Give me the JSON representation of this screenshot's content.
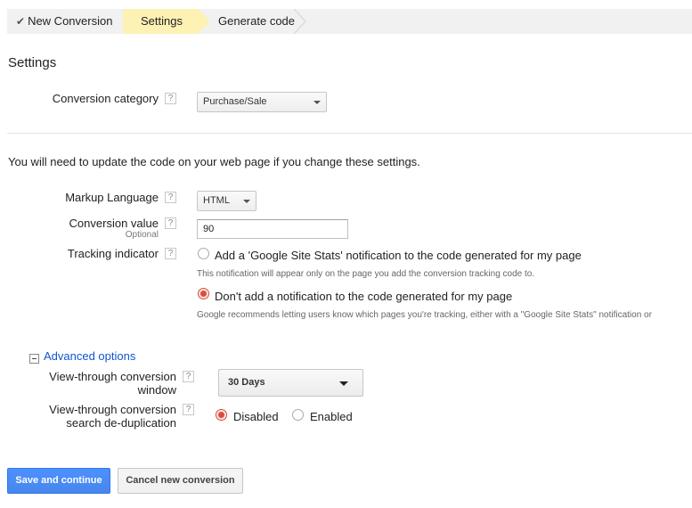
{
  "breadcrumb": {
    "steps": [
      {
        "label": "New Conversion",
        "state": "done"
      },
      {
        "label": "Settings",
        "state": "active"
      },
      {
        "label": "Generate code",
        "state": "pending"
      }
    ]
  },
  "settings": {
    "title": "Settings",
    "conversion_category": {
      "label": "Conversion category",
      "value": "Purchase/Sale"
    }
  },
  "notice": "You will need to update the code on your web page if you change these settings.",
  "markup_language": {
    "label": "Markup Language",
    "value": "HTML"
  },
  "conversion_value": {
    "label": "Conversion value",
    "sublabel": "Optional",
    "value": "90"
  },
  "tracking_indicator": {
    "label": "Tracking indicator",
    "options": [
      {
        "label": "Add a 'Google Site Stats' notification to the code generated for my page",
        "hint": "This notification will appear only on the page you add the conversion tracking code to.",
        "selected": false
      },
      {
        "label": "Don't add a notification to the code generated for my page",
        "hint": "Google recommends letting users know which pages you're tracking, either with a \"Google Site Stats\" notification or",
        "selected": true
      }
    ]
  },
  "advanced": {
    "toggle_label": "Advanced options",
    "view_through_window": {
      "label_line1": "View-through conversion",
      "label_line2": "window",
      "value": "30 Days"
    },
    "dedup": {
      "label_line1": "View-through conversion",
      "label_line2": "search de-duplication",
      "options": [
        {
          "label": "Disabled",
          "selected": true
        },
        {
          "label": "Enabled",
          "selected": false
        }
      ]
    }
  },
  "help_glyph": "?",
  "buttons": {
    "save": "Save and continue",
    "cancel": "Cancel new conversion"
  },
  "colors": {
    "active_step": "#fdf1b4",
    "primary_button": "#4d90fe",
    "link": "#1155cc",
    "radio_selected": "#dd4b39"
  }
}
